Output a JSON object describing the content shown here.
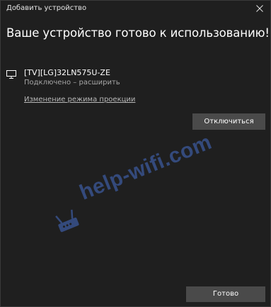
{
  "window": {
    "title": "Добавить устройство"
  },
  "main": {
    "heading": "Ваше устройство готово к использованию!",
    "device": {
      "icon": "monitor-icon",
      "name": "[TV][LG]32LN575U-ZE",
      "status": "Подключено – расширить"
    },
    "projection_mode_link": "Изменение режима проекции",
    "disconnect_label": "Отключиться"
  },
  "footer": {
    "done_label": "Готово"
  },
  "watermark": {
    "text": "help-wifi.com",
    "color": "#466ec8"
  },
  "colors": {
    "background": "#1f1f1f",
    "button": "#4a4a4a",
    "secondary_text": "#a6a6a6"
  }
}
